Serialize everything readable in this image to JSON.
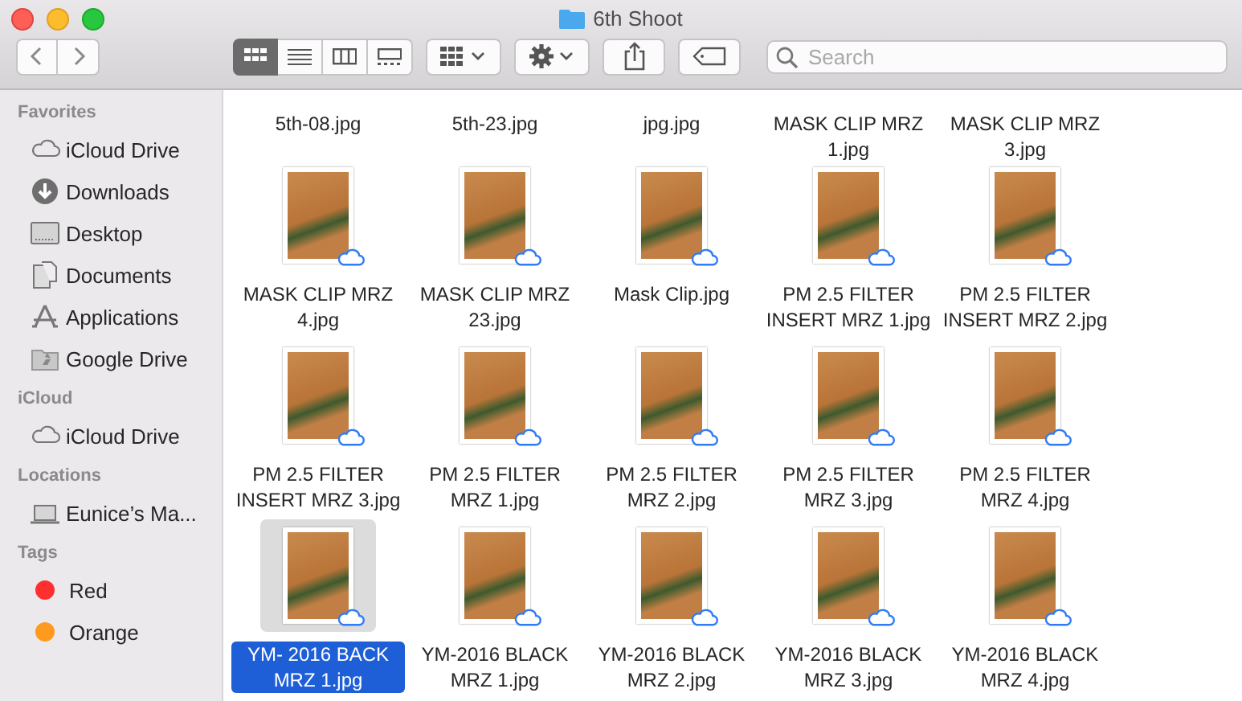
{
  "window": {
    "title": "6th Shoot"
  },
  "toolbar": {
    "views": [
      {
        "kind": "icons",
        "selected": true
      },
      {
        "kind": "list",
        "selected": false
      },
      {
        "kind": "columns",
        "selected": false
      },
      {
        "kind": "gallery",
        "selected": false
      }
    ],
    "search": {
      "placeholder": "Search"
    }
  },
  "sidebar": {
    "sections": [
      {
        "heading": "Favorites",
        "items": [
          {
            "label": "iCloud Drive",
            "kind": "cloud"
          },
          {
            "label": "Downloads",
            "kind": "download"
          },
          {
            "label": "Desktop",
            "kind": "desktop"
          },
          {
            "label": "Documents",
            "kind": "documents"
          },
          {
            "label": "Applications",
            "kind": "applications"
          },
          {
            "label": "Google Drive",
            "kind": "drive"
          }
        ]
      },
      {
        "heading": "iCloud",
        "items": [
          {
            "label": "iCloud Drive",
            "kind": "cloud"
          }
        ]
      },
      {
        "heading": "Locations",
        "items": [
          {
            "label": "Eunice’s Ma...",
            "kind": "laptop"
          }
        ]
      },
      {
        "heading": "Tags",
        "items": [
          {
            "label": "Red",
            "kind": "tag",
            "color": "#fe2f2f"
          },
          {
            "label": "Orange",
            "kind": "tag",
            "color": "#fe9a1e"
          }
        ]
      }
    ]
  },
  "files": [
    {
      "name": "5th-08.jpg",
      "kind": "label-only",
      "selected": false
    },
    {
      "name": "5th-23.jpg",
      "kind": "label-only",
      "selected": false
    },
    {
      "name": "jpg.jpg",
      "kind": "label-only",
      "selected": false
    },
    {
      "name": "MASK CLIP MRZ 1.jpg",
      "kind": "label-only",
      "selected": false
    },
    {
      "name": "MASK CLIP MRZ 3.jpg",
      "kind": "label-only",
      "selected": false
    },
    {
      "name": "MASK CLIP MRZ 4.jpg",
      "kind": "photo",
      "selected": false
    },
    {
      "name": "MASK CLIP MRZ 23.jpg",
      "kind": "photo",
      "selected": false
    },
    {
      "name": "Mask Clip.jpg",
      "kind": "photo",
      "selected": false
    },
    {
      "name": "PM 2.5 FILTER INSERT MRZ 1.jpg",
      "kind": "photo",
      "selected": false
    },
    {
      "name": "PM 2.5 FILTER INSERT MRZ 2.jpg",
      "kind": "photo",
      "selected": false
    },
    {
      "name": "PM 2.5 FILTER INSERT MRZ 3.jpg",
      "kind": "photo",
      "selected": false
    },
    {
      "name": "PM 2.5 FILTER MRZ 1.jpg",
      "kind": "photo",
      "selected": false
    },
    {
      "name": "PM 2.5 FILTER MRZ 2.jpg",
      "kind": "photo",
      "selected": false
    },
    {
      "name": "PM 2.5 FILTER MRZ 3.jpg",
      "kind": "photo",
      "selected": false
    },
    {
      "name": "PM 2.5 FILTER MRZ 4.jpg",
      "kind": "photo",
      "selected": false
    },
    {
      "name": "YM- 2016 BACK MRZ 1.jpg",
      "kind": "photo",
      "selected": true
    },
    {
      "name": "YM-2016 BLACK MRZ 1.jpg",
      "kind": "photo",
      "selected": false
    },
    {
      "name": "YM-2016 BLACK MRZ 2.jpg",
      "kind": "photo",
      "selected": false
    },
    {
      "name": "YM-2016 BLACK MRZ 3.jpg",
      "kind": "photo",
      "selected": false
    },
    {
      "name": "YM-2016 BLACK MRZ 4.jpg",
      "kind": "photo",
      "selected": false
    }
  ]
}
